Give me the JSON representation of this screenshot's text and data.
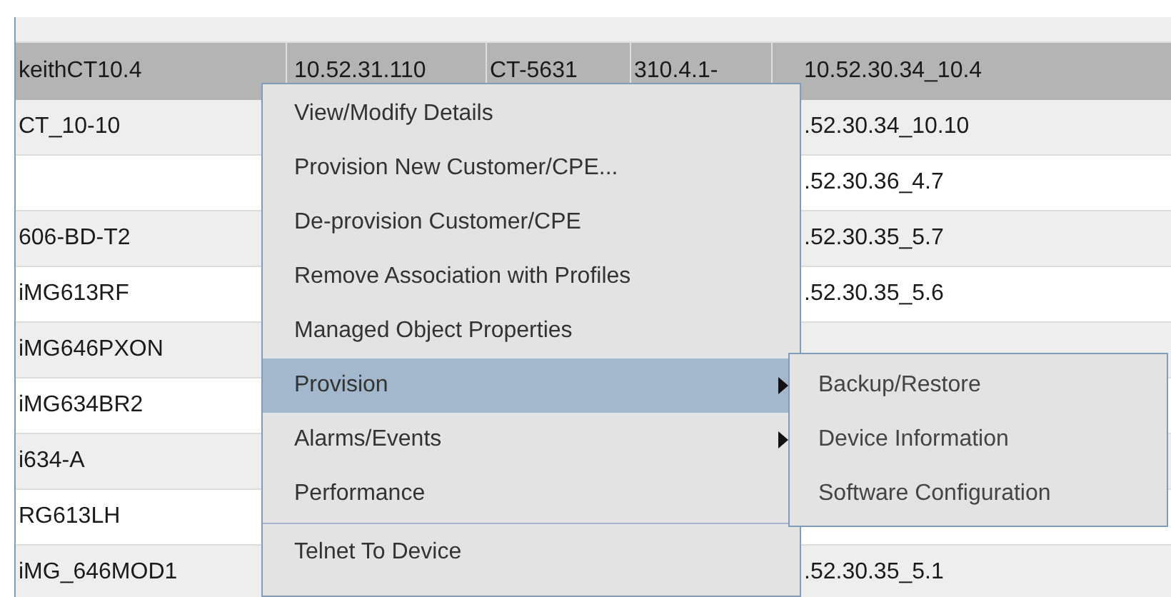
{
  "table": {
    "rows": [
      {
        "cells": [
          "keithCT10.4",
          "10.52.31.110",
          "CT-5631",
          "310.4.1-",
          "10.52.30.34_10.4"
        ],
        "selected": true
      },
      {
        "cells": [
          "CT_10-10",
          "",
          "",
          "",
          ".52.30.34_10.10"
        ],
        "selected": false
      },
      {
        "cells": [
          "",
          "",
          "",
          "",
          ".52.30.36_4.7"
        ],
        "selected": false
      },
      {
        "cells": [
          "606-BD-T2",
          "",
          "",
          "",
          ".52.30.35_5.7"
        ],
        "selected": false
      },
      {
        "cells": [
          "iMG613RF",
          "",
          "",
          "",
          ".52.30.35_5.6"
        ],
        "selected": false
      },
      {
        "cells": [
          "iMG646PXON",
          "",
          "",
          "",
          ""
        ],
        "selected": false
      },
      {
        "cells": [
          "iMG634BR2",
          "",
          "",
          "",
          ""
        ],
        "selected": false
      },
      {
        "cells": [
          "i634-A",
          "",
          "",
          "",
          ""
        ],
        "selected": false
      },
      {
        "cells": [
          "RG613LH",
          "",
          "",
          "",
          ""
        ],
        "selected": false
      },
      {
        "cells": [
          "iMG_646MOD1",
          "",
          "",
          "",
          ".52.30.35_5.1"
        ],
        "selected": false
      }
    ]
  },
  "context_menu": {
    "items": [
      {
        "kind": "item",
        "label": "View/Modify Details",
        "selected": false,
        "submenu": false
      },
      {
        "kind": "item",
        "label": "Provision New Customer/CPE...",
        "selected": false,
        "submenu": false
      },
      {
        "kind": "item",
        "label": "De-provision Customer/CPE",
        "selected": false,
        "submenu": false
      },
      {
        "kind": "item",
        "label": "Remove Association with Profiles",
        "selected": false,
        "submenu": false
      },
      {
        "kind": "item",
        "label": "Managed Object Properties",
        "selected": false,
        "submenu": false
      },
      {
        "kind": "item",
        "label": "Provision",
        "selected": true,
        "submenu": true
      },
      {
        "kind": "item",
        "label": "Alarms/Events",
        "selected": false,
        "submenu": true
      },
      {
        "kind": "item",
        "label": "Performance",
        "selected": false,
        "submenu": false
      },
      {
        "kind": "separator"
      },
      {
        "kind": "item",
        "label": "Telnet To Device",
        "selected": false,
        "submenu": false
      }
    ]
  },
  "submenu": {
    "items": [
      {
        "label": "Backup/Restore"
      },
      {
        "label": "Device Information"
      },
      {
        "label": "Software Configuration"
      }
    ]
  }
}
